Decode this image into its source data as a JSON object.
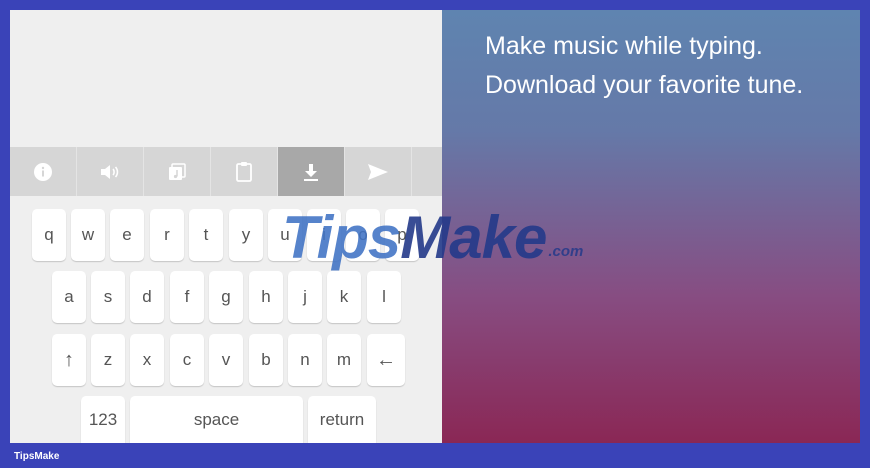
{
  "toolbar": {
    "items": [
      {
        "icon": "info-icon"
      },
      {
        "icon": "volume-icon"
      },
      {
        "icon": "music-note-icon"
      },
      {
        "icon": "clipboard-icon"
      },
      {
        "icon": "download-icon",
        "active": true
      },
      {
        "icon": "send-icon"
      }
    ]
  },
  "keyboard": {
    "row1": [
      "q",
      "w",
      "e",
      "r",
      "t",
      "y",
      "u",
      "i",
      "o",
      "p"
    ],
    "row2": [
      "a",
      "s",
      "d",
      "f",
      "g",
      "h",
      "j",
      "k",
      "l"
    ],
    "row3": [
      "↑",
      "z",
      "x",
      "c",
      "v",
      "b",
      "n",
      "m",
      "←"
    ],
    "numbers_label": "123",
    "space_label": "space",
    "return_label": "return"
  },
  "promo": {
    "line1": "Make music while typing.",
    "line2": "Download your favorite tune."
  },
  "watermark": {
    "tips": "Tips",
    "make": "Make",
    "com": ".com"
  },
  "footer": {
    "label": "TipsMake"
  },
  "colors": {
    "page_border": "#3a43b8",
    "keyboard_bg": "#efefef",
    "toolbar_bg": "#d6d6d6",
    "toolbar_active": "#a8a8a8",
    "gradient_top": "#5f84b0",
    "gradient_bottom": "#8a2755"
  }
}
